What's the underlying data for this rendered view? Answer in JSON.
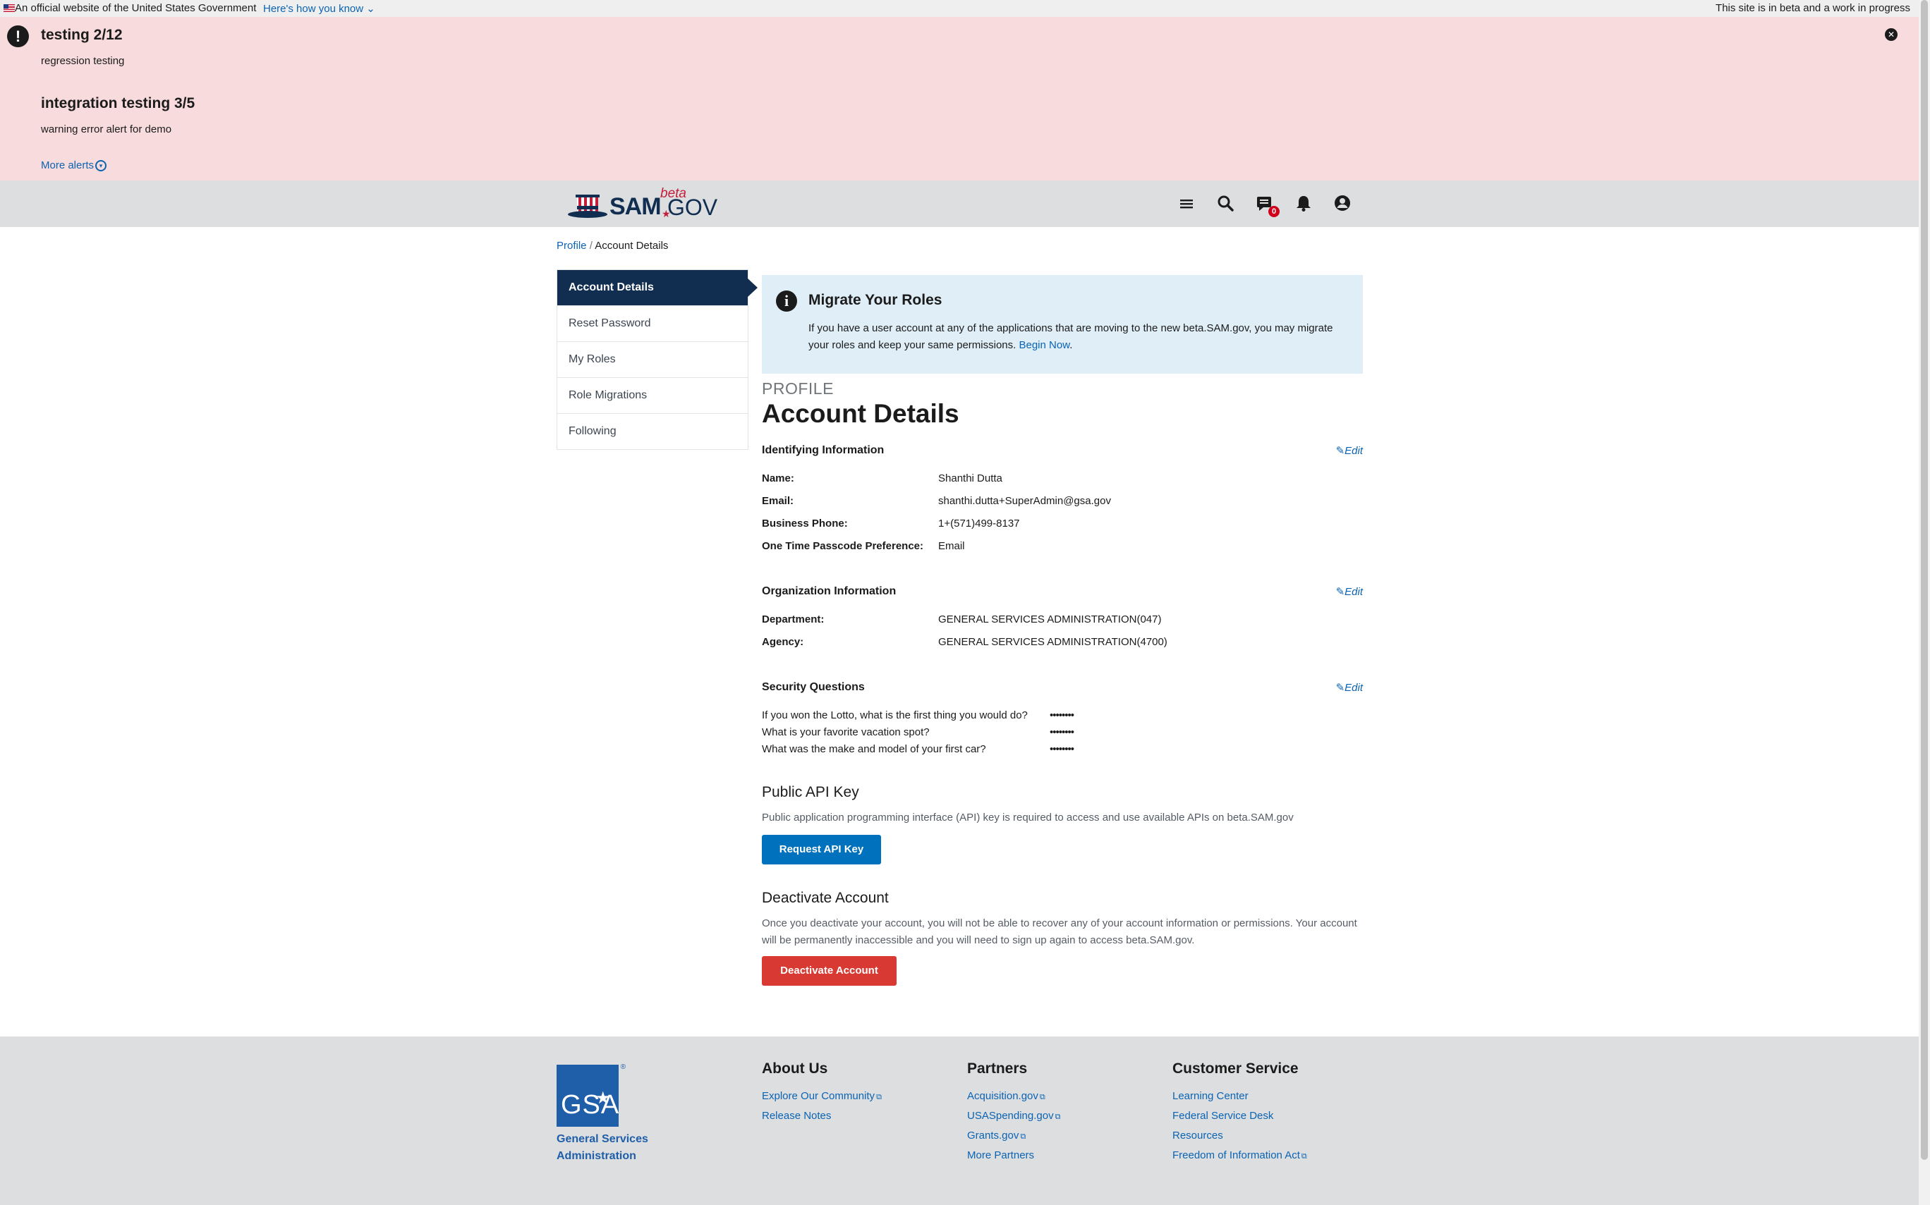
{
  "gov_banner": {
    "official_text": "An official website of the United States Government",
    "how_you_know": "Here's how you know",
    "beta_note": "This site is in beta and a work in progress"
  },
  "alerts": {
    "items": [
      {
        "title": "testing 2/12",
        "text": "regression testing"
      },
      {
        "title": "integration testing 3/5",
        "text": "warning error alert for demo"
      }
    ],
    "more_label": "More alerts"
  },
  "header": {
    "logo_sam": "SAM",
    "logo_beta": "beta",
    "logo_gov": "GOV",
    "message_count": "0"
  },
  "breadcrumb": {
    "parent": "Profile",
    "separator": "/",
    "current": "Account Details"
  },
  "sidenav": {
    "items": [
      {
        "label": "Account Details"
      },
      {
        "label": "Reset Password"
      },
      {
        "label": "My Roles"
      },
      {
        "label": "Role Migrations"
      },
      {
        "label": "Following"
      }
    ]
  },
  "migrate": {
    "title": "Migrate Your Roles",
    "text": "If you have a user account at any of the applications that are moving to the new beta.SAM.gov, you may migrate your roles and keep your same permissions. ",
    "link": "Begin Now",
    "period": "."
  },
  "page": {
    "eyebrow": "PROFILE",
    "title": "Account Details",
    "edit_label": "Edit"
  },
  "identifying": {
    "heading": "Identifying Information",
    "fields": [
      {
        "label": "Name:",
        "value": "Shanthi Dutta"
      },
      {
        "label": "Email:",
        "value": "shanthi.dutta+SuperAdmin@gsa.gov"
      },
      {
        "label": "Business Phone:",
        "value": "1+(571)499-8137"
      },
      {
        "label": "One Time Passcode Preference:",
        "value": "Email"
      }
    ]
  },
  "organization": {
    "heading": "Organization Information",
    "fields": [
      {
        "label": "Department:",
        "value": "GENERAL SERVICES ADMINISTRATION(047)"
      },
      {
        "label": "Agency:",
        "value": "GENERAL SERVICES ADMINISTRATION(4700)"
      }
    ]
  },
  "security": {
    "heading": "Security Questions",
    "questions": [
      {
        "q": "If you won the Lotto, what is the first thing you would do?",
        "a": "••••••••"
      },
      {
        "q": "What is your favorite vacation spot?",
        "a": "••••••••"
      },
      {
        "q": "What was the make and model of your first car?",
        "a": "••••••••"
      }
    ]
  },
  "api": {
    "heading": "Public API Key",
    "text": "Public application programming interface (API) key is required to access and use available APIs on beta.SAM.gov",
    "button": "Request API Key"
  },
  "deactivate": {
    "heading": "Deactivate Account",
    "text": "Once you deactivate your account, you will not be able to recover any of your account information or permissions. Your account will be permanently inaccessible and you will need to sign up again to access beta.SAM.gov.",
    "button": "Deactivate Account"
  },
  "footer": {
    "gsa_logo": "GSA",
    "gsa_name": "General Services Administration",
    "about": {
      "title": "About Us",
      "links": [
        "Explore Our Community",
        "Release Notes"
      ]
    },
    "partners": {
      "title": "Partners",
      "links": [
        "Acquisition.gov",
        "USASpending.gov",
        "Grants.gov",
        "More Partners"
      ]
    },
    "customer": {
      "title": "Customer Service",
      "links": [
        "Learning Center",
        "Federal Service Desk",
        "Resources",
        "Freedom of Information Act"
      ]
    }
  },
  "colors": {
    "navy": "#112e51",
    "link": "#0b63b3",
    "alert_bg": "#f8dbdc",
    "info_bg": "#dfeef7",
    "primary": "#0071bc",
    "danger": "#d83933"
  }
}
